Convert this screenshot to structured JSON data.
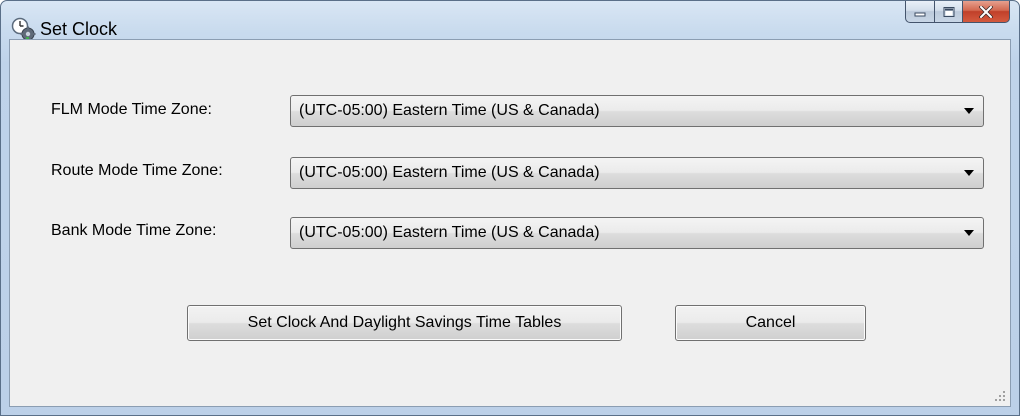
{
  "window": {
    "title": "Set Clock",
    "icon": "clock-gear-icon",
    "controls": {
      "minimize_icon": "minimize-icon",
      "maximize_icon": "maximize-icon",
      "close_icon": "close-icon"
    }
  },
  "form": {
    "rows": [
      {
        "label": "FLM Mode Time Zone:",
        "value": "(UTC-05:00) Eastern Time (US & Canada)"
      },
      {
        "label": "Route Mode Time Zone:",
        "value": "(UTC-05:00) Eastern Time (US & Canada)"
      },
      {
        "label": "Bank Mode Time Zone:",
        "value": "(UTC-05:00) Eastern Time (US & Canada)"
      }
    ]
  },
  "buttons": {
    "set_clock": "Set Clock And Daylight Savings Time Tables",
    "cancel": "Cancel"
  },
  "colors": {
    "frame": "#bcd0e8",
    "client": "#f0f0f0",
    "close_button": "#c9452d"
  }
}
